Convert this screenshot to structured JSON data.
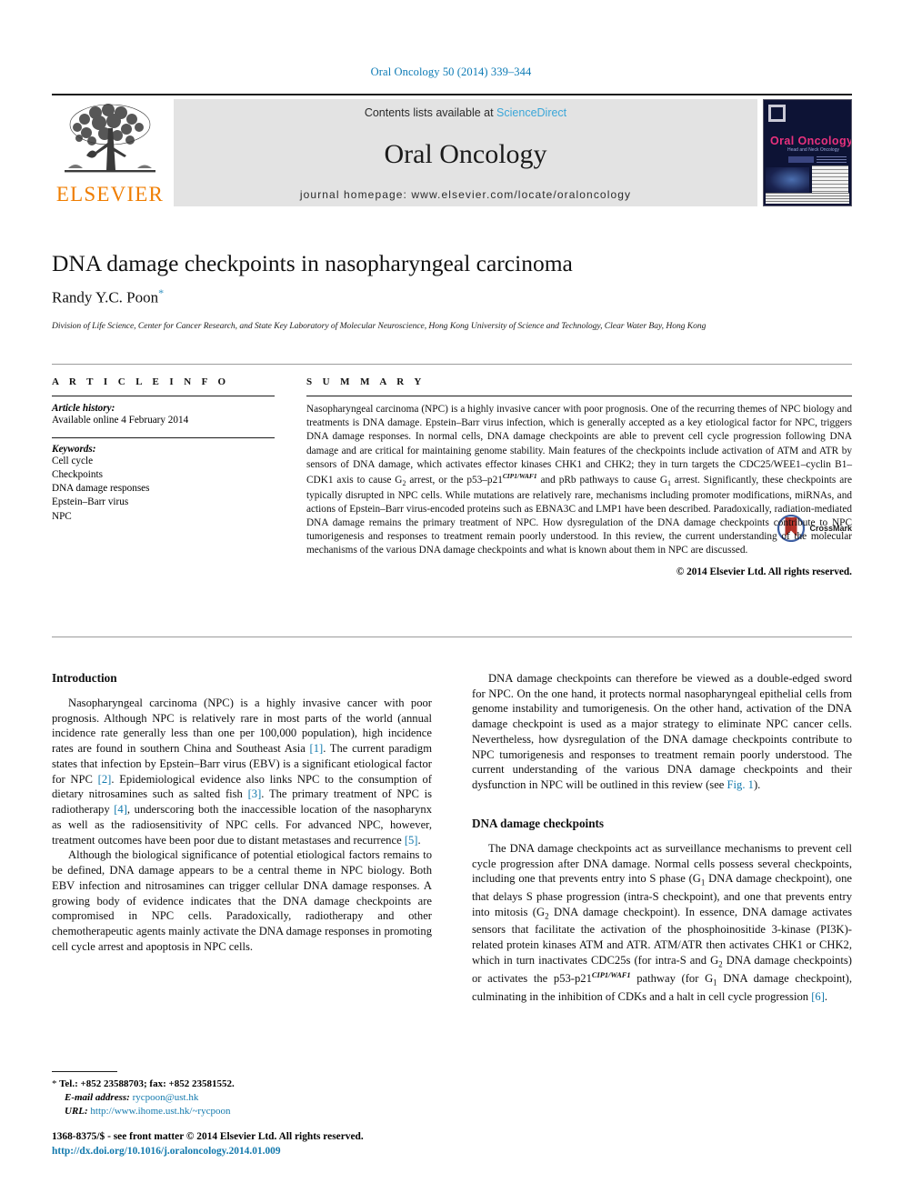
{
  "running_head": "Oral Oncology 50 (2014) 339–344",
  "masthead": {
    "contents_prefix": "Contents lists available at ",
    "sciencedirect": "ScienceDirect",
    "journal_name": "Oral Oncology",
    "homepage": "journal homepage: www.elsevier.com/locate/oraloncology",
    "publisher_wordmark": "ELSEVIER",
    "cover": {
      "title": "Oral Oncology",
      "subtitle": "Head and Neck Oncology"
    }
  },
  "article": {
    "title": "DNA damage checkpoints in nasopharyngeal carcinoma",
    "author": "Randy Y.C. Poon",
    "author_marker": "*",
    "affiliation": "Division of Life Science, Center for Cancer Research, and State Key Laboratory of Molecular Neuroscience, Hong Kong University of Science and Technology, Clear Water Bay, Hong Kong",
    "crossmark_label": "CrossMark"
  },
  "article_info": {
    "heading": "A R T I C L E   I N F O",
    "history_label": "Article history:",
    "history_value": "Available online 4 February 2014",
    "keywords_label": "Keywords:",
    "keywords": [
      "Cell cycle",
      "Checkpoints",
      "DNA damage responses",
      "Epstein–Barr virus",
      "NPC"
    ]
  },
  "summary": {
    "heading": "S U M M A R Y",
    "part1": "Nasopharyngeal carcinoma (NPC) is a highly invasive cancer with poor prognosis. One of the recurring themes of NPC biology and treatments is DNA damage. Epstein–Barr virus infection, which is generally accepted as a key etiological factor for NPC, triggers DNA damage responses. In normal cells, DNA damage checkpoints are able to prevent cell cycle progression following DNA damage and are critical for maintaining genome stability. Main features of the checkpoints include activation of ATM and ATR by sensors of DNA damage, which activates effector kinases CHK1 and CHK2; they in turn targets the CDC25/WEE1–cyclin B1–CDK1 axis to cause G",
    "sub1": "2",
    "part2": " arrest, or the p53–p21",
    "sup1": "CIP1/WAF1",
    "part3": " and pRb pathways to cause G",
    "sub2": "1",
    "part4": " arrest. Significantly, these checkpoints are typically disrupted in NPC cells. While mutations are relatively rare, mechanisms including promoter modifications, miRNAs, and actions of Epstein–Barr virus-encoded proteins such as EBNA3C and LMP1 have been described. Paradoxically, radiation-mediated DNA damage remains the primary treatment of NPC. How dysregulation of the DNA damage checkpoints contribute to NPC tumorigenesis and responses to treatment remain poorly understood. In this review, the current understanding of the molecular mechanisms of the various DNA damage checkpoints and what is known about them in NPC are discussed.",
    "copyright": "© 2014 Elsevier Ltd. All rights reserved."
  },
  "body": {
    "left": {
      "heading": "Introduction",
      "p1_a": "Nasopharyngeal carcinoma (NPC) is a highly invasive cancer with poor prognosis. Although NPC is relatively rare in most parts of the world (annual incidence rate generally less than one per 100,000 population), high incidence rates are found in southern China and Southeast Asia ",
      "p1_r1": "[1]",
      "p1_b": ". The current paradigm states that infection by Epstein–Barr virus (EBV) is a significant etiological factor for NPC ",
      "p1_r2": "[2]",
      "p1_c": ". Epidemiological evidence also links NPC to the consumption of dietary nitrosamines such as salted fish ",
      "p1_r3": "[3]",
      "p1_d": ". The primary treatment of NPC is radiotherapy ",
      "p1_r4": "[4]",
      "p1_e": ", underscoring both the inaccessible location of the nasopharynx as well as the radiosensitivity of NPC cells. For advanced NPC, however, treatment outcomes have been poor due to distant metastases and recurrence ",
      "p1_r5": "[5]",
      "p1_f": ".",
      "p2": "Although the biological significance of potential etiological factors remains to be defined, DNA damage appears to be a central theme in NPC biology. Both EBV infection and nitrosamines can trigger cellular DNA damage responses. A growing body of evidence indicates that the DNA damage checkpoints are compromised in NPC cells. Paradoxically, radiotherapy and other chemotherapeutic agents mainly activate the DNA damage responses in promoting cell cycle arrest and apoptosis in NPC cells."
    },
    "right": {
      "p1_a": "DNA damage checkpoints can therefore be viewed as a double-edged sword for NPC. On the one hand, it protects normal nasopharyngeal epithelial cells from genome instability and tumorigenesis. On the other hand, activation of the DNA damage checkpoint is used as a major strategy to eliminate NPC cancer cells. Nevertheless, how dysregulation of the DNA damage checkpoints contribute to NPC tumorigenesis and responses to treatment remain poorly understood. The current understanding of the various DNA damage checkpoints and their dysfunction in NPC will be outlined in this review (see ",
      "p1_fig": "Fig. 1",
      "p1_b": ").",
      "heading": "DNA damage checkpoints",
      "p2_a": "The DNA damage checkpoints act as surveillance mechanisms to prevent cell cycle progression after DNA damage. Normal cells possess several checkpoints, including one that prevents entry into S phase (G",
      "p2_sub1": "1",
      "p2_b": " DNA damage checkpoint), one that delays S phase progression (intra-S checkpoint), and one that prevents entry into mitosis (G",
      "p2_sub2": "2",
      "p2_c": " DNA damage checkpoint). In essence, DNA damage activates sensors that facilitate the activation of the phosphoinositide 3-kinase (PI3K)-related protein kinases ATM and ATR. ATM/ATR then activates CHK1 or CHK2, which in turn inactivates CDC25s (for intra-S and G",
      "p2_sub3": "2",
      "p2_d": " DNA damage checkpoints) or activates the p53-p21",
      "p2_sup": "CIP1/WAF1",
      "p2_e": " pathway (for G",
      "p2_sub4": "1",
      "p2_f": " DNA damage checkpoint), culminating in the inhibition of CDKs and a halt in cell cycle progression ",
      "p2_r6": "[6]",
      "p2_g": "."
    }
  },
  "footnotes": {
    "star": "*",
    "tel": "Tel.: +852 23588703; fax: +852 23581552.",
    "email_label": "E-mail address:",
    "email": "rycpoon@ust.hk",
    "url_label": "URL:",
    "url": "http://www.ihome.ust.hk/~rycpoon",
    "issn": "1368-8375/$ - see front matter © 2014 Elsevier Ltd. All rights reserved.",
    "doi": "http://dx.doi.org/10.1016/j.oraloncology.2014.01.009"
  },
  "colors": {
    "link": "#1279ad",
    "running_head": "#0b7ab5",
    "elsevier_orange": "#ef7d00",
    "sciencedirect": "#3aa6d8",
    "cover_bg": "#0d1335",
    "cover_title": "#e8317d",
    "crossmark_red": "#b5332a",
    "crossmark_blue": "#3e5fa3"
  }
}
